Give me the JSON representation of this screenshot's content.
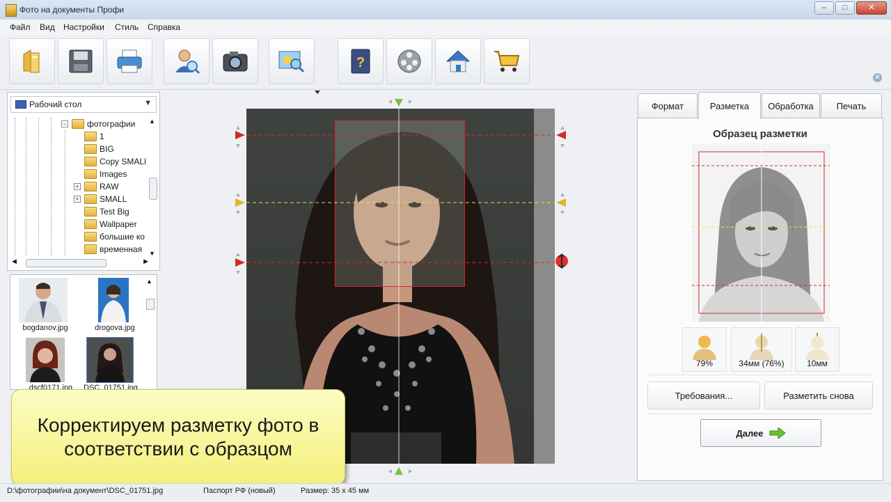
{
  "window": {
    "title": "Фото на документы Профи",
    "buttons": {
      "minimize": "–",
      "maximize": "□",
      "close": "✕"
    }
  },
  "menu": [
    "Файл",
    "Вид",
    "Настройки",
    "Стиль",
    "Справка"
  ],
  "toolbar": {
    "buttons": [
      "open-icon",
      "save-icon",
      "print-icon",
      "user-search-icon",
      "camera-icon",
      "photo-search-icon",
      "help-book-icon",
      "video-reel-icon",
      "home-icon",
      "shopping-cart-icon"
    ],
    "close": "✕"
  },
  "folder_browser": {
    "location": "Рабочий стол",
    "tree": [
      {
        "label": "фотографии",
        "expander": "−"
      },
      {
        "label": "1"
      },
      {
        "label": "BIG"
      },
      {
        "label": "Copy SMALL"
      },
      {
        "label": "Images"
      },
      {
        "label": "RAW",
        "expander": "+"
      },
      {
        "label": "SMALL",
        "expander": "+"
      },
      {
        "label": "Test Big"
      },
      {
        "label": "Wallpaper"
      },
      {
        "label": "большие ко"
      },
      {
        "label": "временная"
      }
    ]
  },
  "thumbnails": [
    {
      "name": "bogdanov.jpg"
    },
    {
      "name": "drogova.jpg"
    },
    {
      "name": "dscf0171.jpg"
    },
    {
      "name": "DSC_01751.jpg",
      "selected": true
    }
  ],
  "overlay": {
    "line1": "Корректируем разметку фото в",
    "line2": "соответствии с образцом"
  },
  "tabs": [
    {
      "label": "Формат"
    },
    {
      "label": "Разметка",
      "active": true
    },
    {
      "label": "Обработка"
    },
    {
      "label": "Печать"
    }
  ],
  "markup_panel": {
    "title": "Образец разметки",
    "stats": [
      {
        "value": "79%"
      },
      {
        "value": "34мм (76%)"
      },
      {
        "value": "10мм"
      }
    ],
    "requirements_button": "Требования...",
    "redo_button": "Разметить снова",
    "next_button": "Далее"
  },
  "status": {
    "path": "D:\\фотографии\\на документ\\DSC_01751.jpg",
    "document": "Паспорт РФ (новый)",
    "size": "Размер: 35 x 45 мм"
  },
  "colors": {
    "accent": "#c82828",
    "guide_yellow": "#e8e04a",
    "marker_green": "#7bc142",
    "overlay_bg": "#f8f5a0"
  }
}
